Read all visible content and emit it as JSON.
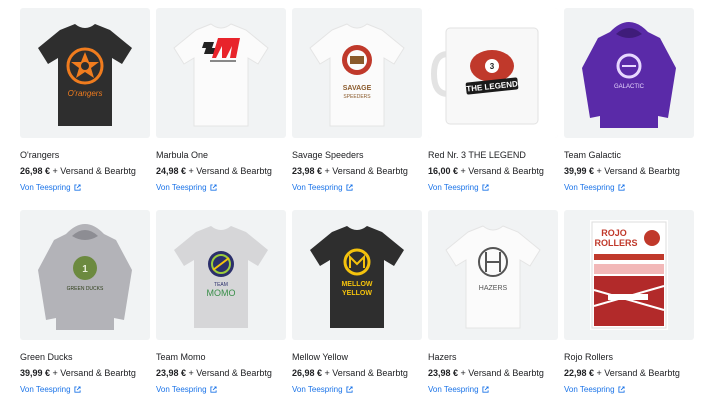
{
  "products": [
    {
      "title": "O'rangers",
      "price": "26,98 €",
      "shipping": "+ Versand & Bearbtg",
      "seller": "Von Teespring",
      "icon": "tshirt-dark-orangers"
    },
    {
      "title": "Marbula One",
      "price": "24,98 €",
      "shipping": "+ Versand & Bearbtg",
      "seller": "Von Teespring",
      "icon": "tshirt-white-marbula"
    },
    {
      "title": "Savage Speeders",
      "price": "23,98 €",
      "shipping": "+ Versand & Bearbtg",
      "seller": "Von Teespring",
      "icon": "tshirt-white-savage"
    },
    {
      "title": "Red Nr. 3 THE LEGEND",
      "price": "16,00 €",
      "shipping": "+ Versand & Bearbtg",
      "seller": "Von Teespring",
      "icon": "mug-legend"
    },
    {
      "title": "Team Galactic",
      "price": "39,99 €",
      "shipping": "+ Versand & Bearbtg",
      "seller": "Von Teespring",
      "icon": "hoodie-purple-galactic"
    },
    {
      "title": "Green Ducks",
      "price": "39,99 €",
      "shipping": "+ Versand & Bearbtg",
      "seller": "Von Teespring",
      "icon": "hoodie-grey-ducks"
    },
    {
      "title": "Team Momo",
      "price": "23,98 €",
      "shipping": "+ Versand & Bearbtg",
      "seller": "Von Teespring",
      "icon": "tshirt-grey-momo"
    },
    {
      "title": "Mellow Yellow",
      "price": "26,98 €",
      "shipping": "+ Versand & Bearbtg",
      "seller": "Von Teespring",
      "icon": "tshirt-dark-mellow"
    },
    {
      "title": "Hazers",
      "price": "23,98 €",
      "shipping": "+ Versand & Bearbtg",
      "seller": "Von Teespring",
      "icon": "tshirt-white-hazers"
    },
    {
      "title": "Rojo Rollers",
      "price": "22,98 €",
      "shipping": "+ Versand & Bearbtg",
      "seller": "Von Teespring",
      "icon": "poster-rojo"
    }
  ],
  "artwork": {
    "orangers": "O'rangers",
    "savage_line1": "SAVAGE",
    "savage_line2": "SPEEDERS",
    "legend": "THE LEGEND",
    "legend_number": "3",
    "galactic": "GALACTIC",
    "ducks": "GREEN DUCKS",
    "momo_line1": "TEAM",
    "momo_line2": "MOMO",
    "mellow_line1": "MELLOW",
    "mellow_line2": "YELLOW",
    "hazers": "HAZERS",
    "rojo_line1": "ROJO",
    "rojo_line2": "ROLLERS"
  },
  "colors": {
    "link": "#1a73e8",
    "thumb_bg": "#f1f3f4",
    "accent_orange": "#f07c1e",
    "marbula_red": "#e8242b",
    "purple_hoodie": "#5a2aa8",
    "mellow_yellow": "#f4c20d"
  }
}
